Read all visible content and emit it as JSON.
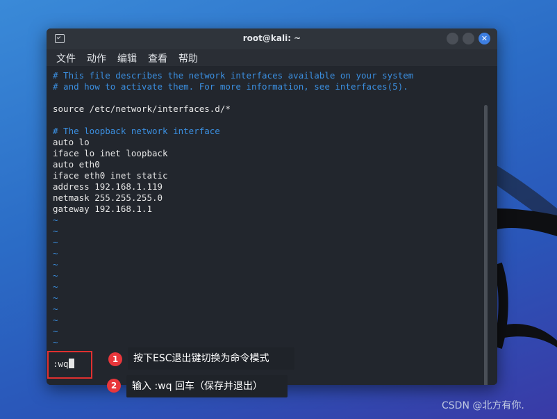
{
  "window": {
    "title": "root@kali: ~",
    "icon": "terminal-icon",
    "buttons": {
      "minimize": "minimize-icon",
      "maximize": "maximize-icon",
      "close": "close-icon",
      "close_glyph": "✕"
    }
  },
  "menubar": {
    "items": [
      "文件",
      "动作",
      "编辑",
      "查看",
      "帮助"
    ]
  },
  "editor": {
    "lines": [
      "# This file describes the network interfaces available on your system",
      "# and how to activate them. For more information, see interfaces(5).",
      "",
      "source /etc/network/interfaces.d/*",
      "",
      "# The loopback network interface",
      "auto lo",
      "iface lo inet loopback",
      "auto eth0",
      "iface eth0 inet static",
      "address 192.168.1.119",
      "netmask 255.255.255.0",
      "gateway 192.168.1.1"
    ],
    "tilde": "~",
    "tilde_count": 12,
    "command": ":wq"
  },
  "annotations": [
    {
      "number": "1",
      "text": "按下ESC退出键切换为命令模式"
    },
    {
      "number": "2",
      "text": "输入 :wq 回车（保存并退出）"
    }
  ],
  "watermark": "CSDN @北方有你.",
  "colors": {
    "comment": "#3b8fe0",
    "badge": "#e8363b",
    "highlight_border": "#e03030",
    "close_button": "#3d7ee0"
  }
}
